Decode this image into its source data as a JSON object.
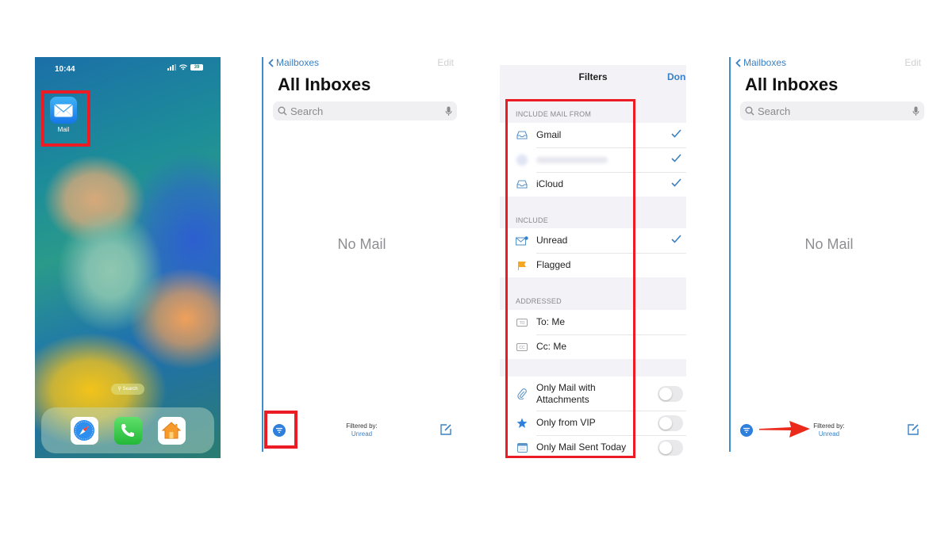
{
  "home_screen": {
    "status_time": "10:44",
    "battery": "39",
    "mail_app_label": "Mail",
    "search_pill": "Search",
    "dock_apps": [
      "Safari",
      "Phone",
      "Home"
    ]
  },
  "mail_list_before": {
    "back_label": "Mailboxes",
    "edit_label": "Edit",
    "title": "All Inboxes",
    "search_placeholder": "Search",
    "empty_text": "No Mail",
    "filtered_label": "Filtered by:",
    "filtered_value": "Unread"
  },
  "filters_sheet": {
    "title": "Filters",
    "done_label": "Done",
    "sections": [
      {
        "header": "INCLUDE MAIL FROM",
        "rows": [
          {
            "icon": "inbox-icon",
            "label": "Gmail",
            "checked": true
          },
          {
            "icon": "blurred-account-icon",
            "label": "",
            "checked": true
          },
          {
            "icon": "inbox-icon",
            "label": "iCloud",
            "checked": true
          }
        ]
      },
      {
        "header": "INCLUDE",
        "rows": [
          {
            "icon": "unread-envelope-icon",
            "label": "Unread",
            "checked": true
          },
          {
            "icon": "flag-icon",
            "label": "Flagged",
            "checked": false
          }
        ]
      },
      {
        "header": "ADDRESSED",
        "rows": [
          {
            "icon": "to-icon",
            "label": "To: Me",
            "checked": false
          },
          {
            "icon": "cc-icon",
            "label": "Cc: Me",
            "checked": false
          }
        ]
      },
      {
        "header": "",
        "rows": [
          {
            "icon": "paperclip-icon",
            "label": "Only Mail with Attachments",
            "toggle": false
          },
          {
            "icon": "star-icon",
            "label": "Only from VIP",
            "toggle": false
          },
          {
            "icon": "calendar-icon",
            "label": "Only Mail Sent Today",
            "toggle": false
          }
        ]
      }
    ]
  },
  "mail_list_after": {
    "back_label": "Mailboxes",
    "edit_label": "Edit",
    "title": "All Inboxes",
    "search_placeholder": "Search",
    "empty_text": "No Mail",
    "filtered_label": "Filtered by:",
    "filtered_value": "Unread"
  },
  "colors": {
    "highlight_red": "#ec1c24",
    "ios_blue": "#3a80c4",
    "filter_button_blue": "#2f7fdc"
  }
}
